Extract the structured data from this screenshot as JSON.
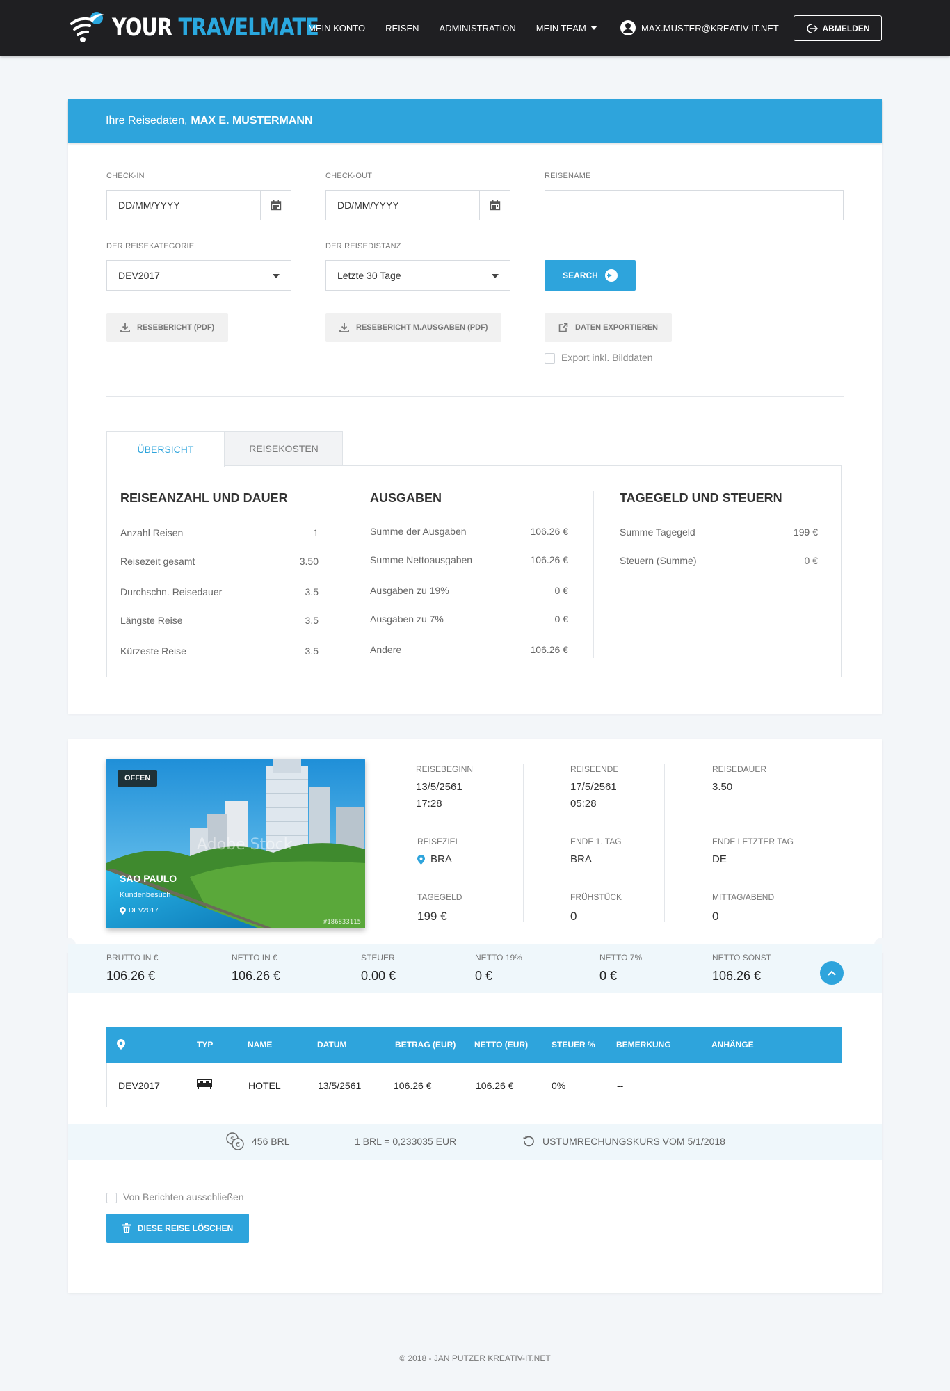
{
  "nav": {
    "logo_part1": "YOUR",
    "logo_part2": "TRAVELMATE",
    "links": [
      "MEIN KONTO",
      "REISEN",
      "ADMINISTRATION",
      "MEIN TEAM"
    ],
    "user_email": "MAX.MUSTER@KREATIV-IT.NET",
    "logout_label": "ABMELDEN"
  },
  "header": {
    "prefix": "Ihre Reisedaten,",
    "name": "MAX E. MUSTERMANN"
  },
  "filters": {
    "checkin_label": "CHECK-IN",
    "checkin_placeholder": "DD/MM/YYYY",
    "checkout_label": "CHECK-OUT",
    "checkout_placeholder": "DD/MM/YYYY",
    "reisename_label": "REISENAME",
    "reisename_value": "",
    "kategorie_label": "DER REISEKATEGORIE",
    "kategorie_value": "DEV2017",
    "distanz_label": "DER REISEDISTANZ",
    "distanz_value": "Letzte 30 Tage",
    "search_label": "SEARCH"
  },
  "actions": {
    "report_pdf": "RESEBERICHT (PDF)",
    "report_expenses_pdf": "RESEBERICHT M.AUSGABEN (PDF)",
    "export_data": "DATEN EXPORTIEREN",
    "export_images_label": "Export inkl. Bilddaten"
  },
  "tabs": [
    "ÜBERSICHT",
    "REISEKOSTEN"
  ],
  "overview": {
    "col1": {
      "title": "REISEANZAHL UND DAUER",
      "rows": [
        {
          "label": "Anzahl Reisen",
          "value": "1"
        },
        {
          "label": "Reisezeit gesamt",
          "value": "3.50"
        },
        {
          "label": "Durchschn. Reisedauer",
          "value": "3.5"
        },
        {
          "label": "Längste Reise",
          "value": "3.5"
        },
        {
          "label": "Kürzeste Reise",
          "value": "3.5"
        }
      ]
    },
    "col2": {
      "title": "AUSGABEN",
      "rows": [
        {
          "label": "Summe der Ausgaben",
          "value": "106.26 €"
        },
        {
          "label": "Summe Nettoausgaben",
          "value": "106.26 €"
        },
        {
          "label": "Ausgaben zu 19%",
          "value": "0 €"
        },
        {
          "label": "Ausgaben zu 7%",
          "value": "0 €"
        },
        {
          "label": "Andere",
          "value": "106.26 €"
        }
      ]
    },
    "col3": {
      "title": "TAGEGELD UND STEUERN",
      "rows": [
        {
          "label": "Summe Tagegeld",
          "value": "199 €"
        },
        {
          "label": "Steuern (Summe)",
          "value": "0 €"
        }
      ]
    }
  },
  "trip": {
    "status": "OFFEN",
    "city": "SAO PAULO",
    "subtitle": "Kundenbesuch",
    "tag": "DEV2017",
    "watermark": "Adobe Stock",
    "photo_id": "#186833115",
    "details": {
      "start_label": "REISEBEGINN",
      "start_date": "13/5/2561",
      "start_time": "17:28",
      "end_label": "REISEENDE",
      "end_date": "17/5/2561",
      "end_time": "05:28",
      "duration_label": "REISEDAUER",
      "duration": "3.50",
      "dest_label": "REISEZIEL",
      "dest": "BRA",
      "end_first_label": "ENDE 1. TAG",
      "end_first": "BRA",
      "end_last_label": "ENDE LETZTER TAG",
      "end_last": "DE",
      "per_diem_label": "TAGEGELD",
      "per_diem": "199 €",
      "breakfast_label": "FRÜHSTÜCK",
      "breakfast": "0",
      "lunch_label": "MITTAG/ABEND",
      "lunch": "0"
    },
    "totals": [
      {
        "label": "BRUTTO IN €",
        "value": "106.26 €"
      },
      {
        "label": "NETTO IN €",
        "value": "106.26 €"
      },
      {
        "label": "STEUER",
        "value": "0.00 €"
      },
      {
        "label": "NETTO 19%",
        "value": "0 €"
      },
      {
        "label": "NETTO 7%",
        "value": "0 €"
      },
      {
        "label": "NETTO SONST",
        "value": "106.26 €"
      }
    ]
  },
  "expenses": {
    "headers": [
      "TYP",
      "NAME",
      "DATUM",
      "BETRAG (EUR)",
      "NETTO (EUR)",
      "STEUER %",
      "BEMERKUNG",
      "ANHÄNGE"
    ],
    "row": {
      "location": "DEV2017",
      "name": "HOTEL",
      "date": "13/5/2561",
      "amount": "106.26 €",
      "net": "106.26 €",
      "tax": "0%",
      "note": "--",
      "attachments": ""
    }
  },
  "fx": {
    "amount": "456 BRL",
    "rate": "1 BRL = 0,233035 EUR",
    "rate_date": "USTUMRECHUNGSKURS VOM 5/1/2018"
  },
  "bottom": {
    "exclude_label": "Von Berichten ausschließen",
    "delete_label": "DIESE REISE LÖSCHEN"
  },
  "footer": "© 2018 - JAN PUTZER KREATIV-IT.NET",
  "colors": {
    "accent": "#2ea4dc",
    "navbar": "#1f1f22",
    "background": "#f3f6f9",
    "badge": "#1f3238"
  }
}
